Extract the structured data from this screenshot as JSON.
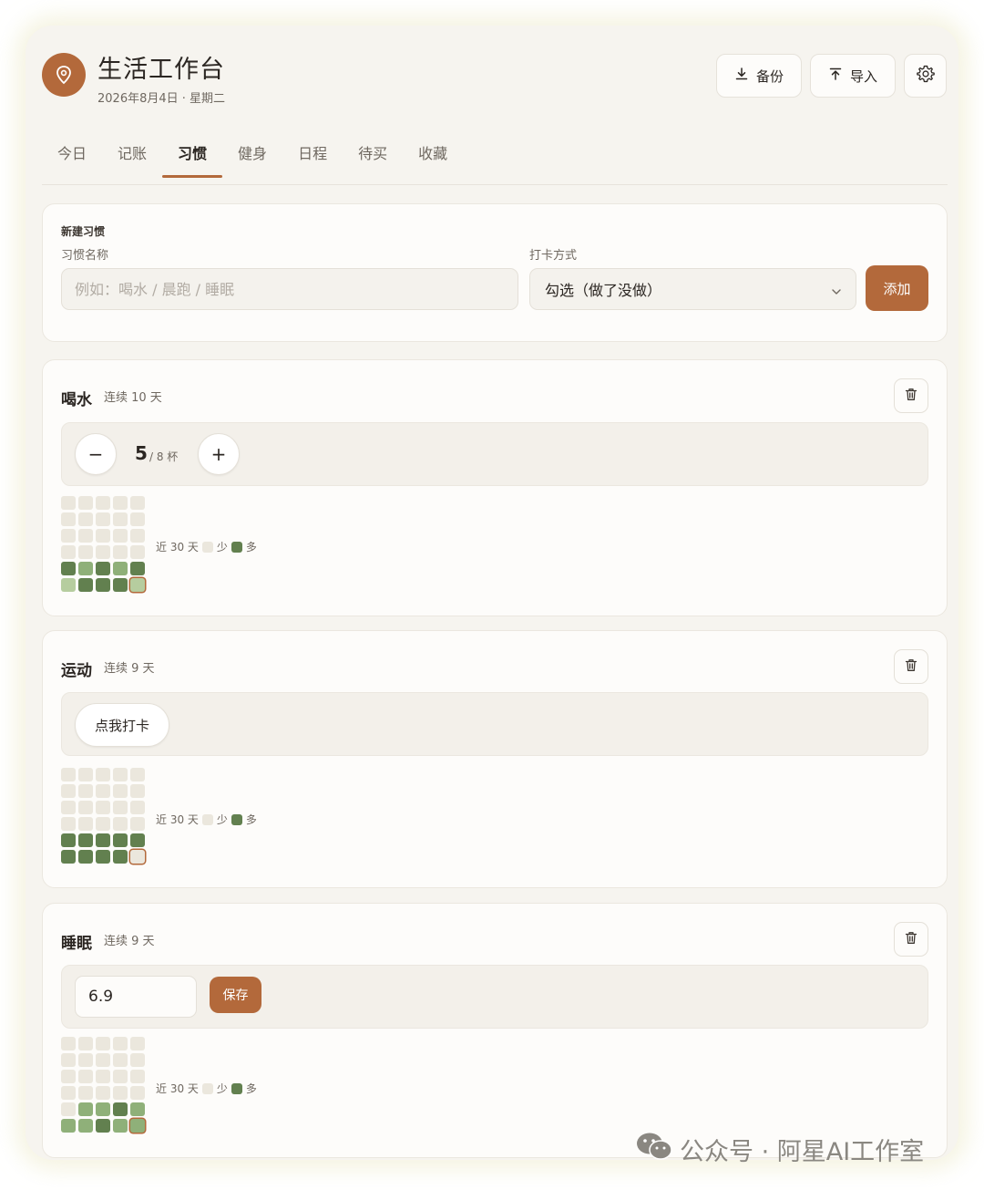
{
  "header": {
    "app_title": "生活工作台",
    "date": "2026年8月4日 · 星期二",
    "backup_label": "备份",
    "import_label": "导入"
  },
  "tabs": [
    {
      "label": "今日",
      "active": false
    },
    {
      "label": "记账",
      "active": false
    },
    {
      "label": "习惯",
      "active": true
    },
    {
      "label": "健身",
      "active": false
    },
    {
      "label": "日程",
      "active": false
    },
    {
      "label": "待买",
      "active": false
    },
    {
      "label": "收藏",
      "active": false
    }
  ],
  "new_habit": {
    "title": "新建习惯",
    "name_label": "习惯名称",
    "name_placeholder": "例如：喝水 / 晨跑 / 睡眠",
    "mode_label": "打卡方式",
    "mode_value": "勾选（做了没做）",
    "add_label": "添加"
  },
  "habits": [
    {
      "name": "喝水",
      "streak": "连续 10 天",
      "type": "count",
      "count": "5",
      "target": "/ 8 杯",
      "minus": "−",
      "plus": "+",
      "heatmap": [
        0,
        0,
        0,
        0,
        0,
        0,
        0,
        0,
        0,
        0,
        0,
        0,
        0,
        0,
        0,
        0,
        0,
        0,
        0,
        0,
        3,
        2,
        3,
        2,
        3,
        1,
        3,
        3,
        3,
        1
      ],
      "legend": {
        "recent": "近 30 天",
        "less": "少",
        "more": "多"
      }
    },
    {
      "name": "运动",
      "streak": "连续 9 天",
      "type": "check",
      "check_label": "点我打卡",
      "heatmap": [
        0,
        0,
        0,
        0,
        0,
        0,
        0,
        0,
        0,
        0,
        0,
        0,
        0,
        0,
        0,
        0,
        0,
        0,
        0,
        0,
        3,
        3,
        3,
        3,
        3,
        3,
        3,
        3,
        3,
        0
      ],
      "legend": {
        "recent": "近 30 天",
        "less": "少",
        "more": "多"
      }
    },
    {
      "name": "睡眠",
      "streak": "连续 9 天",
      "type": "value",
      "value": "6.9",
      "save_label": "保存",
      "heatmap": [
        0,
        0,
        0,
        0,
        0,
        0,
        0,
        0,
        0,
        0,
        0,
        0,
        0,
        0,
        0,
        0,
        0,
        0,
        0,
        0,
        0,
        2,
        2,
        3,
        2,
        2,
        2,
        3,
        2,
        2
      ],
      "legend": {
        "recent": "近 30 天",
        "less": "少",
        "more": "多"
      }
    }
  ],
  "colors": {
    "accent": "#b3693b",
    "background": "#f6f4ef",
    "card": "#fdfcfa",
    "heat_empty": "#ebe7dd",
    "heat_light": "#b6cd9f",
    "heat_mid": "#8fb079",
    "heat_dark": "#62804f"
  },
  "icons": {
    "logo": "map-pin-icon",
    "backup": "download-icon",
    "import": "upload-icon",
    "settings": "gear-icon",
    "delete": "trash-icon",
    "select": "chevron-down-icon"
  },
  "watermark": "公众号 · 阿星AI工作室"
}
